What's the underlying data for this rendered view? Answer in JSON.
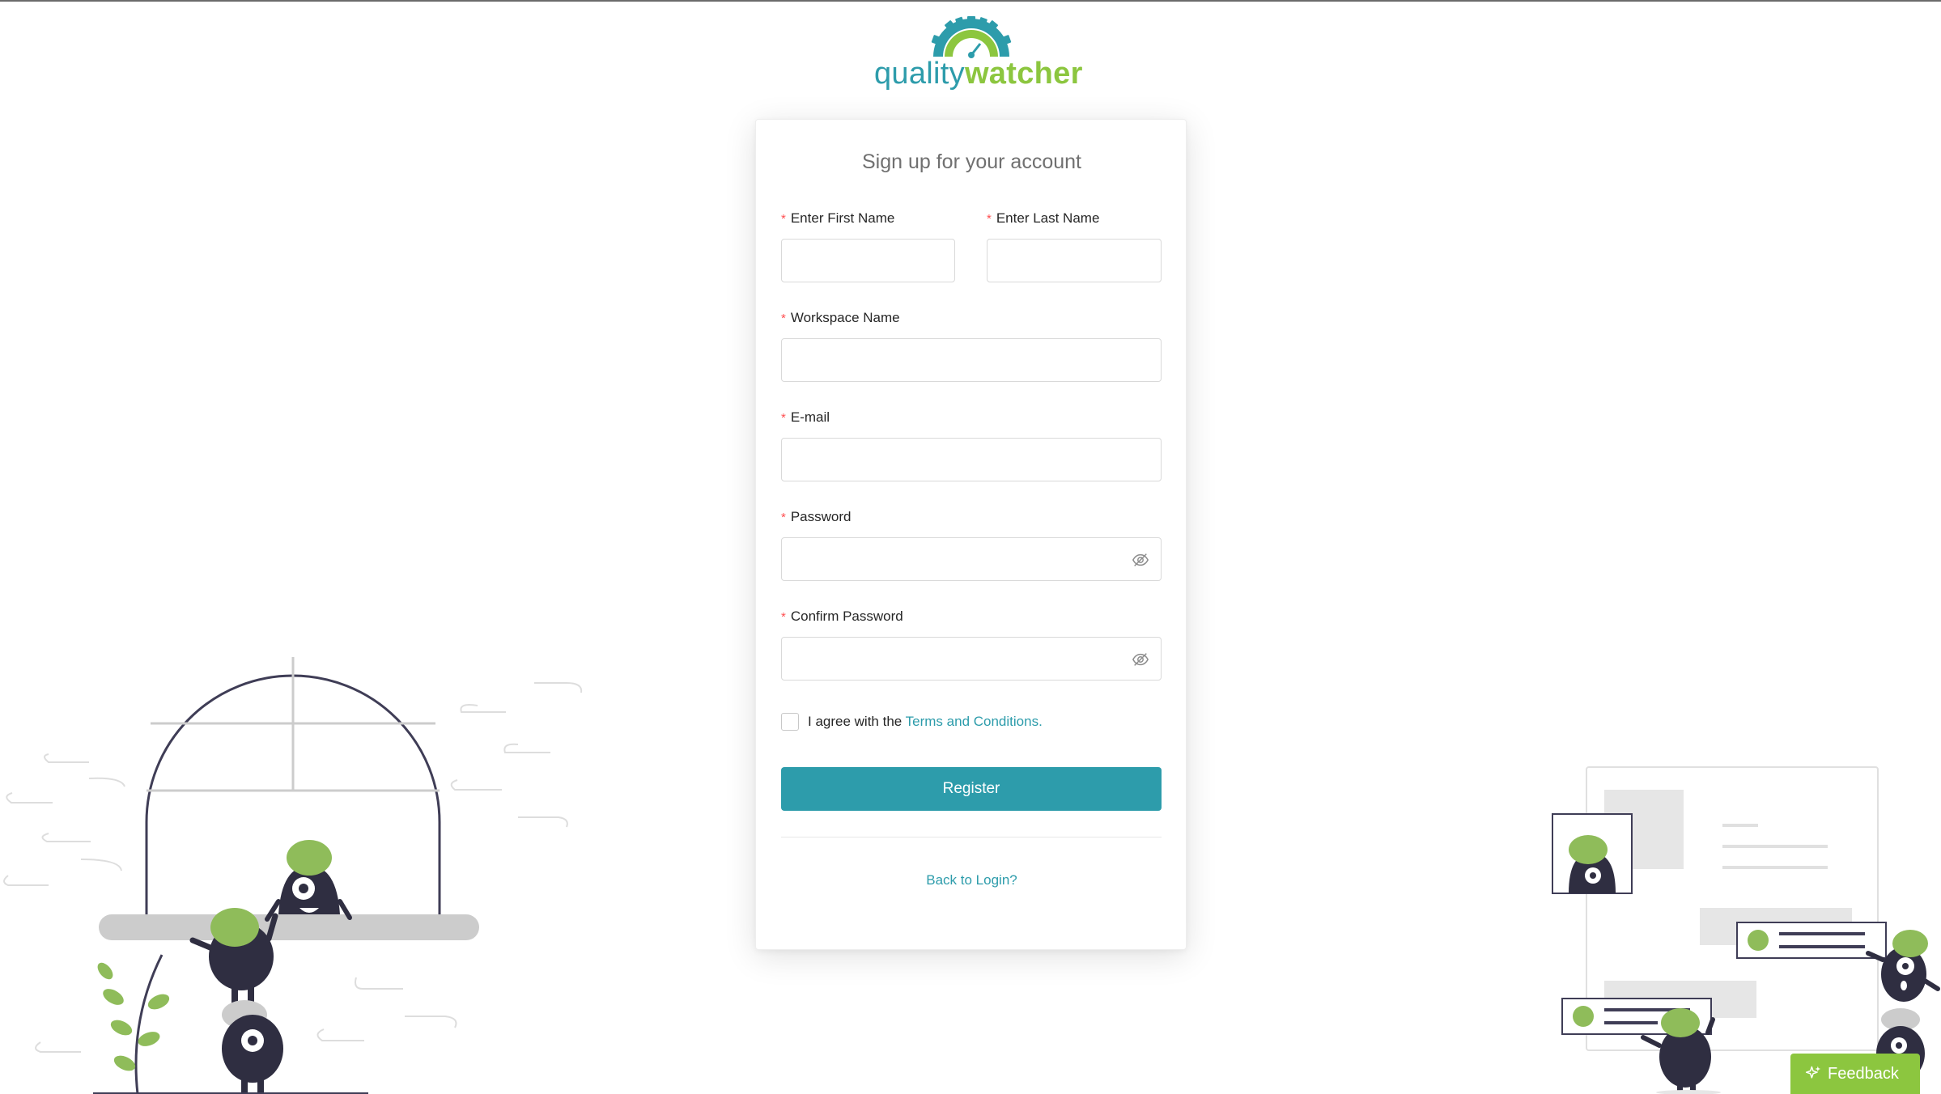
{
  "logo": {
    "text_part1": "quality",
    "text_part2": "watcher",
    "colors": {
      "teal": "#2d9cab",
      "green": "#8cc63f"
    }
  },
  "form": {
    "title": "Sign up for your account",
    "required_mark": "*",
    "fields": {
      "first_name": {
        "label": "Enter First Name",
        "value": ""
      },
      "last_name": {
        "label": "Enter Last Name",
        "value": ""
      },
      "workspace": {
        "label": "Workspace Name",
        "value": ""
      },
      "email": {
        "label": "E-mail",
        "value": ""
      },
      "password": {
        "label": "Password",
        "value": "",
        "icon": "eye-invisible-icon"
      },
      "confirm_password": {
        "label": "Confirm Password",
        "value": "",
        "icon": "eye-invisible-icon"
      }
    },
    "agree": {
      "checked": false,
      "text": "I agree with the ",
      "link": "Terms and Conditions."
    },
    "register_label": "Register",
    "back_link": "Back to Login?"
  },
  "feedback": {
    "label": "Feedback",
    "icon": "sparkle-icon"
  },
  "colors": {
    "primary": "#2d9cab",
    "accent": "#8cc63f",
    "required": "#ff4d4f",
    "illustration_dark": "#2f2e41"
  }
}
